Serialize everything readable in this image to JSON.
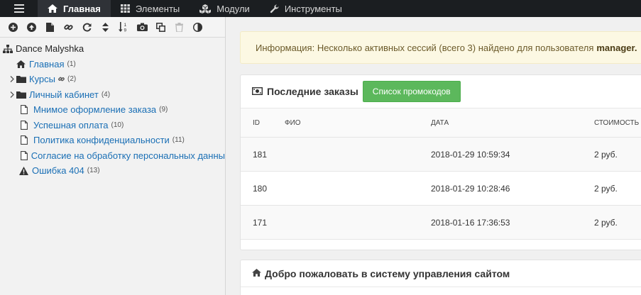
{
  "topnav": {
    "tabs": [
      {
        "label": "Главная",
        "icon": "home-icon",
        "active": true
      },
      {
        "label": "Элементы",
        "icon": "grid-icon"
      },
      {
        "label": "Модули",
        "icon": "cubes-icon"
      },
      {
        "label": "Инструменты",
        "icon": "wrench-icon"
      }
    ]
  },
  "tree": {
    "root": "Dance Malyshka",
    "items": [
      {
        "label": "Главная",
        "count": "(1)",
        "icon": "home-icon"
      },
      {
        "label": "Курсы",
        "count": "(2)",
        "icon": "folder-icon",
        "expandable": true
      },
      {
        "label": "Личный кабинет",
        "count": "(4)",
        "icon": "folder-icon",
        "expandable": true
      },
      {
        "label": "Мнимое оформление заказа",
        "count": "(9)",
        "icon": "file-icon"
      },
      {
        "label": "Успешная оплата",
        "count": "(10)",
        "icon": "file-icon"
      },
      {
        "label": "Политика конфиденциальности",
        "count": "(11)",
        "icon": "file-icon"
      },
      {
        "label": "Согласие на обработку персональных данны",
        "count": "",
        "icon": "file-icon"
      },
      {
        "label": "Ошибка 404",
        "count": "(13)",
        "icon": "warning-icon"
      }
    ]
  },
  "alert": {
    "text": "Информация: Несколько активных сессий (всего 3) найдено для пользователя",
    "user": "manager."
  },
  "orders": {
    "title": "Последние заказы",
    "button": "Список промокодов",
    "columns": {
      "id": "ID",
      "fio": "ФИО",
      "date": "ДАТА",
      "cost": "СТОИМОСТЬ"
    },
    "rows": [
      {
        "id": "181",
        "fio": "",
        "date": "2018-01-29 10:59:34",
        "cost": "2 руб."
      },
      {
        "id": "180",
        "fio": "",
        "date": "2018-01-29 10:28:46",
        "cost": "2 руб."
      },
      {
        "id": "171",
        "fio": "",
        "date": "2018-01-16 17:36:53",
        "cost": "2 руб."
      }
    ]
  },
  "welcome": {
    "title": "Добро пожаловать в систему управления сайтом"
  },
  "colors": {
    "nav_bg": "#1b1e21",
    "link": "#1a6fb5",
    "alert_bg": "#fcf8e3",
    "button_green": "#5cb85c"
  }
}
